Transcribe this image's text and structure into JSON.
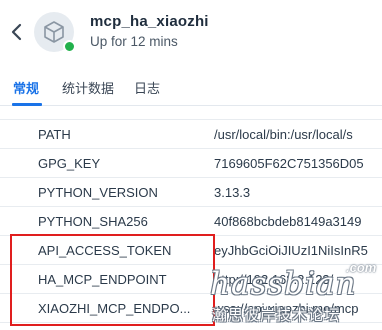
{
  "header": {
    "title": "mcp_ha_xiaozhi",
    "status": "Up for 12 mins",
    "status_color": "#22b14c"
  },
  "tabs": [
    {
      "label": "常规",
      "active": true
    },
    {
      "label": "统计数据",
      "active": false
    },
    {
      "label": "日志",
      "active": false
    }
  ],
  "env_rows": [
    {
      "key": "PATH",
      "value": "/usr/local/bin:/usr/local/s"
    },
    {
      "key": "GPG_KEY",
      "value": "7169605F62C751356D05"
    },
    {
      "key": "PYTHON_VERSION",
      "value": "3.13.3"
    },
    {
      "key": "PYTHON_SHA256",
      "value": "40f868bcbdeb8149a3149"
    },
    {
      "key": "API_ACCESS_TOKEN",
      "value": "eyJhbGciOiJIUzI1NiIsInR5"
    },
    {
      "key": "HA_MCP_ENDPOINT",
      "value": "http://192.168.2.123/"
    },
    {
      "key": "XIAOZHI_MCP_ENDPO...",
      "value": "wss://api.xiaozhi.me/mcp"
    }
  ],
  "watermark": {
    "com": ".com",
    "main": "hassbian",
    "sub": "瀚思彼岸技术论坛"
  },
  "colors": {
    "accent": "#1a73e8",
    "highlight": "#e01e1e"
  }
}
